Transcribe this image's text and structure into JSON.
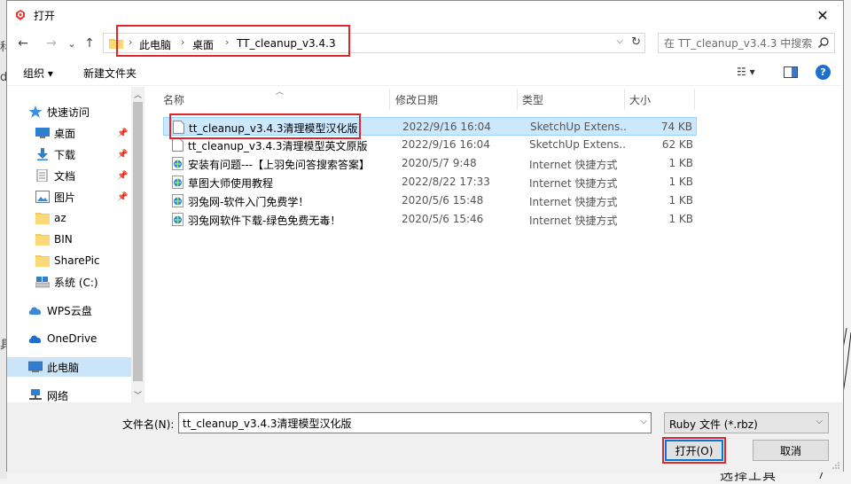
{
  "window": {
    "title": "打开"
  },
  "nav": {
    "back": "←",
    "forward": "→",
    "recent": "⌄",
    "up": "↑"
  },
  "address": {
    "crumbs": [
      "此电脑",
      "桌面",
      "TT_cleanup_v3.4.3"
    ]
  },
  "search": {
    "placeholder": "在 TT_cleanup_v3.4.3 中搜索"
  },
  "toolbar": {
    "organize": "组织 ▾",
    "new_folder": "新建文件夹"
  },
  "sidebar": {
    "items": [
      {
        "label": "快速访问",
        "icon": "star-icon"
      },
      {
        "label": "桌面",
        "icon": "desktop-icon",
        "pinned": true
      },
      {
        "label": "下载",
        "icon": "download-icon",
        "pinned": true
      },
      {
        "label": "文档",
        "icon": "document-icon",
        "pinned": true
      },
      {
        "label": "图片",
        "icon": "picture-icon",
        "pinned": true
      },
      {
        "label": "az",
        "icon": "folder-icon"
      },
      {
        "label": "BIN",
        "icon": "folder-icon"
      },
      {
        "label": "SharePic",
        "icon": "folder-icon"
      },
      {
        "label": "系统 (C:)",
        "icon": "drive-icon"
      },
      {
        "label": "WPS云盘",
        "icon": "cloud-icon"
      },
      {
        "label": "OneDrive",
        "icon": "cloud-icon"
      },
      {
        "label": "此电脑",
        "icon": "computer-icon",
        "selected": true
      },
      {
        "label": "网络",
        "icon": "network-icon"
      }
    ]
  },
  "columns": {
    "name": "名称",
    "date": "修改日期",
    "type": "类型",
    "size": "大小"
  },
  "files": [
    {
      "name": "tt_cleanup_v3.4.3清理模型汉化版",
      "date": "2022/9/16 16:04",
      "type": "SketchUp Extens...",
      "size": "74 KB",
      "icon": "file-icon",
      "selected": true
    },
    {
      "name": "tt_cleanup_v3.4.3清理模型英文原版",
      "date": "2022/9/16 16:04",
      "type": "SketchUp Extens...",
      "size": "62 KB",
      "icon": "file-icon"
    },
    {
      "name": "安装有问题---【上羽免问答搜索答案】",
      "date": "2020/5/7 9:48",
      "type": "Internet 快捷方式",
      "size": "1 KB",
      "icon": "internet-shortcut-icon"
    },
    {
      "name": "草图大师使用教程",
      "date": "2022/8/22 17:33",
      "type": "Internet 快捷方式",
      "size": "1 KB",
      "icon": "internet-shortcut-icon"
    },
    {
      "name": "羽兔网-软件入门免费学！",
      "date": "2020/5/6 15:48",
      "type": "Internet 快捷方式",
      "size": "1 KB",
      "icon": "internet-shortcut-icon"
    },
    {
      "name": "羽兔网软件下载-绿色免费无毒！",
      "date": "2020/5/6 15:46",
      "type": "Internet 快捷方式",
      "size": "1 KB",
      "icon": "internet-shortcut-icon"
    }
  ],
  "footer": {
    "filename_label": "文件名(N):",
    "filename_value": "tt_cleanup_v3.4.3清理模型汉化版",
    "filetype": "Ruby 文件 (*.rbz)",
    "open": "打开(O)",
    "cancel": "取消"
  },
  "background": {
    "edge_glyphs": [
      "科",
      "d",
      "具"
    ],
    "bottom_text": "选择工具"
  },
  "colors": {
    "highlight": "#e0262b",
    "selection": "#cce8ff",
    "accent": "#0078d7"
  }
}
